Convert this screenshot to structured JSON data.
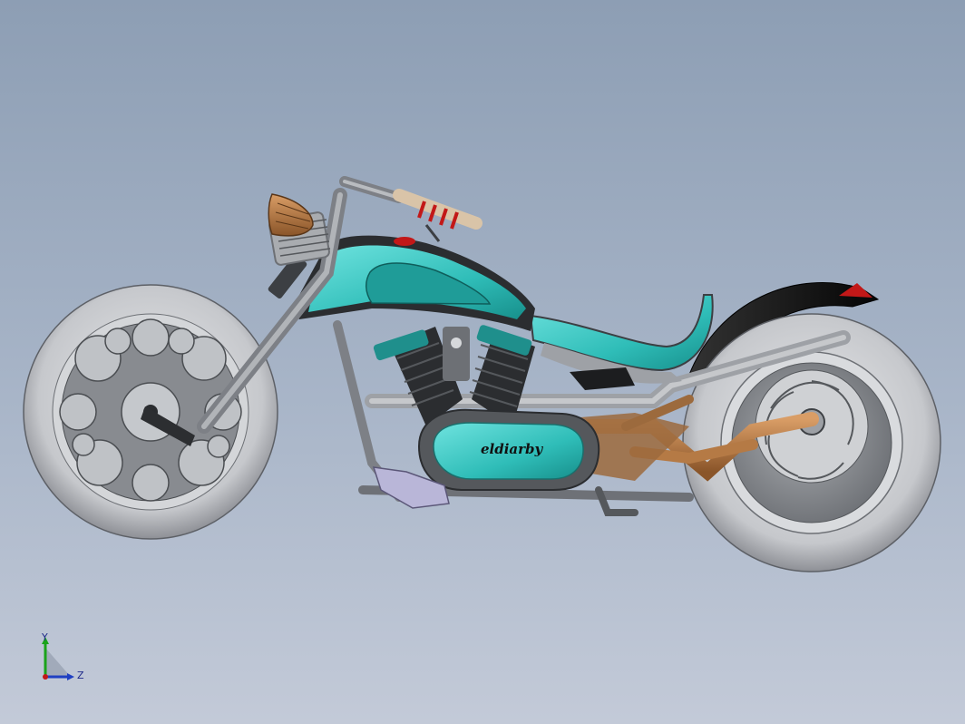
{
  "model": {
    "tank_brand_text": "eldiarby"
  },
  "triad": {
    "y_label": "Y",
    "z_label": "Z"
  },
  "colors": {
    "background_top": "#8d9eb4",
    "background_bottom": "#c3cad8",
    "paint_teal": "#3ec9c4",
    "frame_gray": "#8e9298",
    "tire_gray": "#c7c9cc",
    "copper": "#b57a45",
    "fender_black": "#151515"
  },
  "icons": [
    "view-triad-icon"
  ]
}
